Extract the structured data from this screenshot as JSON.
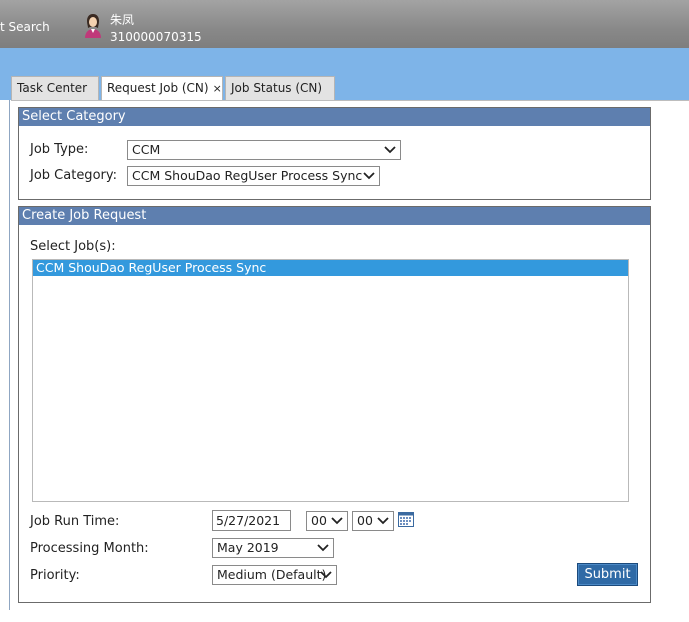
{
  "header": {
    "search_label": "t Search",
    "user_name": "朱凤",
    "user_id": "310000070315",
    "avatar_icon": "user-icon"
  },
  "tabs": [
    {
      "label": "Task Center",
      "active": false
    },
    {
      "label": "Request Job (CN)",
      "active": true,
      "close": "×"
    },
    {
      "label": "Job Status (CN)",
      "active": false
    }
  ],
  "select_category": {
    "title": "Select Category",
    "job_type_label": "Job Type:",
    "job_type_value": "CCM",
    "job_category_label": "Job Category:",
    "job_category_value": "CCM ShouDao RegUser Process Sync"
  },
  "create_job": {
    "title": "Create Job Request",
    "select_jobs_label": "Select Job(s):",
    "jobs": [
      {
        "label": "CCM ShouDao RegUser Process Sync",
        "selected": true
      }
    ],
    "run_time_label": "Job Run Time:",
    "run_date": "5/27/2021",
    "run_hour": "00",
    "run_minute": "00",
    "processing_month_label": "Processing Month:",
    "processing_month": "May 2019",
    "priority_label": "Priority:",
    "priority": "Medium (Default)",
    "submit_label": "Submit"
  },
  "colors": {
    "header_bg": "#8f8f8f",
    "band": "#7eb4e8",
    "panel_head": "#5e7faf",
    "selection": "#3399dd",
    "button": "#2f6aa6"
  }
}
